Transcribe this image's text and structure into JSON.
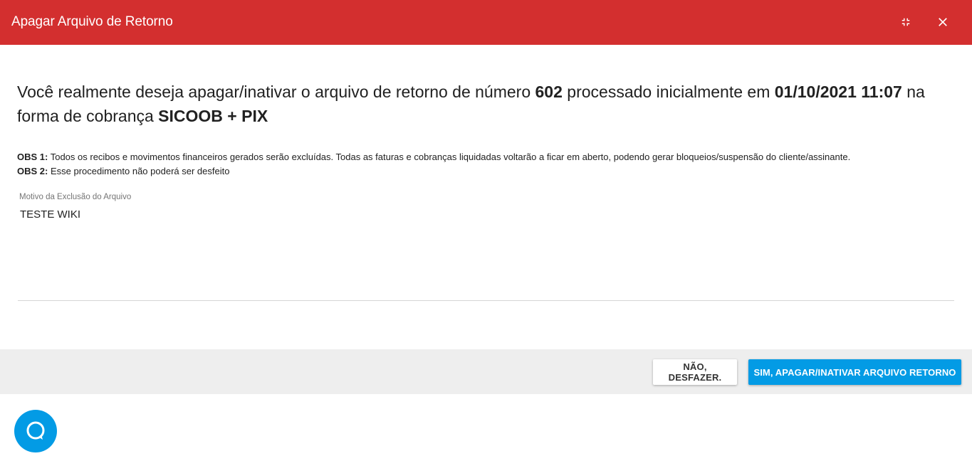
{
  "dialog": {
    "title": "Apagar Arquivo de Retorno",
    "header_color": "#d32f2f",
    "icons": {
      "collapse": "fullscreen-exit-icon",
      "close": "close-icon"
    }
  },
  "message": {
    "part1": "Você realmente deseja apagar/inativar o arquivo de retorno de número ",
    "file_number": "602",
    "part2": " processado inicialmente em ",
    "processed_at": "01/10/2021 11:07",
    "part3": " na forma de cobrança ",
    "billing_method": "SICOOB + PIX"
  },
  "observations": [
    {
      "label": "OBS 1:",
      "text": " Todos os recibos e movimentos financeiros gerados serão excluídas. Todas as faturas e cobranças liquidadas voltarão a ficar em aberto, podendo gerar bloqueios/suspensão do cliente/assinante."
    },
    {
      "label": "OBS 2:",
      "text": " Esse procedimento não poderá ser desfeito"
    }
  ],
  "reason_field": {
    "label": "Motivo da Exclusão do Arquivo",
    "value": "TESTE WIKI"
  },
  "footer": {
    "cancel_label": "NÃO, DESFAZER.",
    "confirm_label": "SIM, APAGAR/INATIVAR ARQUIVO RETORNO",
    "confirm_color": "#039be5"
  },
  "chat_widget": {
    "icon": "chat-icon",
    "color": "#039be5"
  }
}
